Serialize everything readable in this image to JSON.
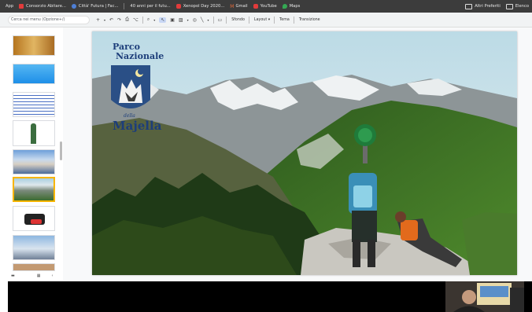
{
  "bookmarks": {
    "items": [
      {
        "label": "App",
        "color": ""
      },
      {
        "label": "Consorzio Abitare...",
        "color": "#e23b3b"
      },
      {
        "label": "Città' Futura | Fac...",
        "color": "#4e7fd6"
      },
      {
        "label": "40 anni per il futu...",
        "color": ""
      },
      {
        "label": "Xenopol Day 2020...",
        "color": "#e23b3b"
      },
      {
        "label": "Gmail",
        "color": "#e06a3a"
      },
      {
        "label": "YouTube",
        "color": "#e23b3b"
      },
      {
        "label": "Maps",
        "color": "#34a853"
      }
    ],
    "right": [
      {
        "label": "Altri Preferiti"
      },
      {
        "label": "Elenco"
      }
    ]
  },
  "toolbar": {
    "menu_search": "Cerca nei menu (Opzione+/)",
    "background_label": "Sfondo",
    "layout_label": "Layout",
    "theme_label": "Tema",
    "transition_label": "Transizione"
  },
  "slide": {
    "logo": {
      "line1": "Parco",
      "line2": "Nazionale",
      "line3": "della",
      "line4": "Majella"
    }
  },
  "colors": {
    "accent": "#f7b500",
    "logo_blue": "#1d3e7a",
    "toolbar_bg": "#f1f3f4",
    "bookmarks_bg": "#3c3c3c"
  }
}
